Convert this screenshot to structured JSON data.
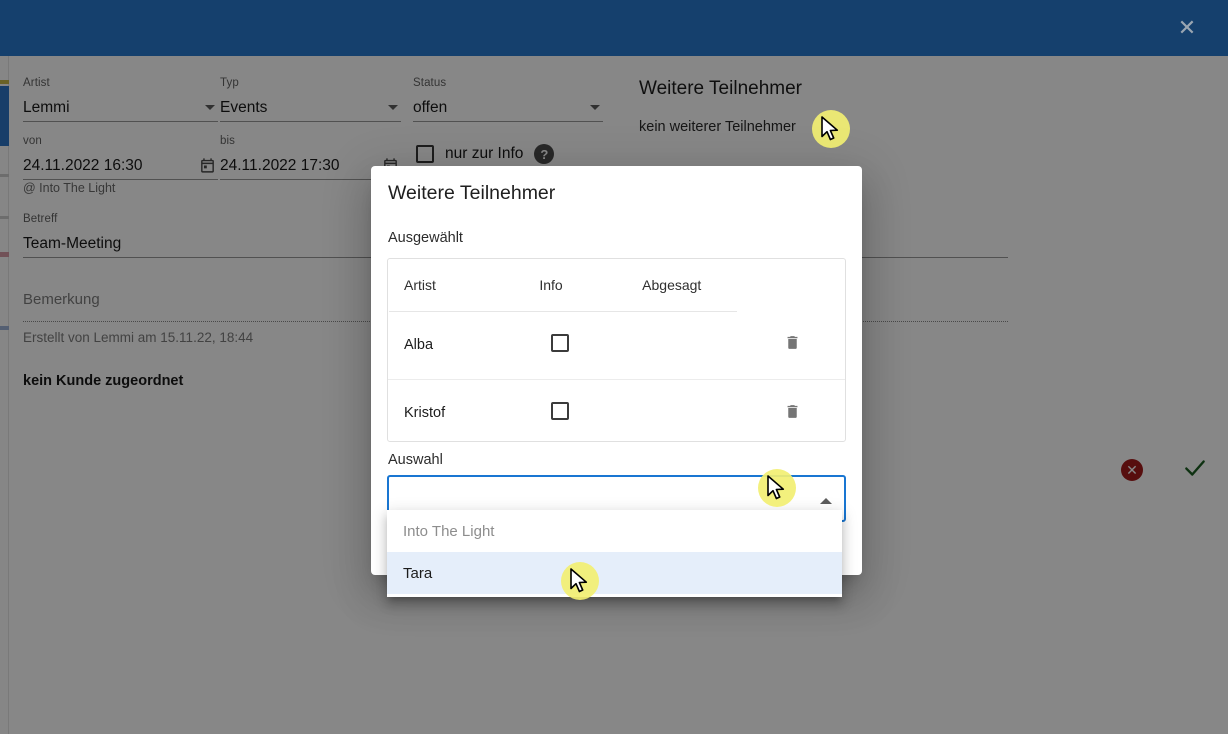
{
  "window": {
    "close_icon": "close-icon",
    "header_color": "#15406d"
  },
  "form": {
    "fields": [
      {
        "label": "Artist",
        "value": "Lemmi",
        "control": "select"
      },
      {
        "label": "Typ",
        "value": "Events",
        "control": "select"
      },
      {
        "label": "Status",
        "value": "offen",
        "control": "select"
      },
      {
        "label": "von",
        "value": "24.11.2022 16:30",
        "control": "datetime"
      },
      {
        "label": "bis",
        "value": "24.11.2022 17:30",
        "control": "datetime"
      }
    ],
    "location": "@ Into The Light",
    "subject_label": "Betreff",
    "subject_value": "Team-Meeting",
    "remark_placeholder": "Bemerkung",
    "created_text": "Erstellt von Lemmi am 15.11.22, 18:44",
    "customer_text": "kein Kunde zugeordnet",
    "info_checkbox_label": "nur zur Info",
    "info_checkbox_checked": false,
    "help_icon": "help-circle-icon"
  },
  "participants_panel": {
    "title": "Weitere Teilnehmer",
    "empty_text": "kein weiterer Teilnehmer"
  },
  "actions": {
    "cancel_label": "✕",
    "cancel_color": "#a41c1c",
    "confirm_label": "check-icon",
    "confirm_color": "#1b5e20"
  },
  "dialog": {
    "title": "Weitere Teilnehmer",
    "selected_label": "Ausgewählt",
    "table": {
      "columns": [
        "Artist",
        "Info",
        "Abgesagt",
        ""
      ],
      "rows": [
        {
          "artist": "Alba",
          "info_checked": false,
          "abgesagt": "",
          "delete_icon": "trash-icon"
        },
        {
          "artist": "Kristof",
          "info_checked": false,
          "abgesagt": "",
          "delete_icon": "trash-icon"
        }
      ]
    },
    "selection_label": "Auswahl",
    "select_value": "",
    "select_arrow": "chevron-up-icon",
    "options": [
      {
        "label": "Into The Light",
        "state": "disabled"
      },
      {
        "label": "Tara",
        "state": "active"
      }
    ]
  }
}
